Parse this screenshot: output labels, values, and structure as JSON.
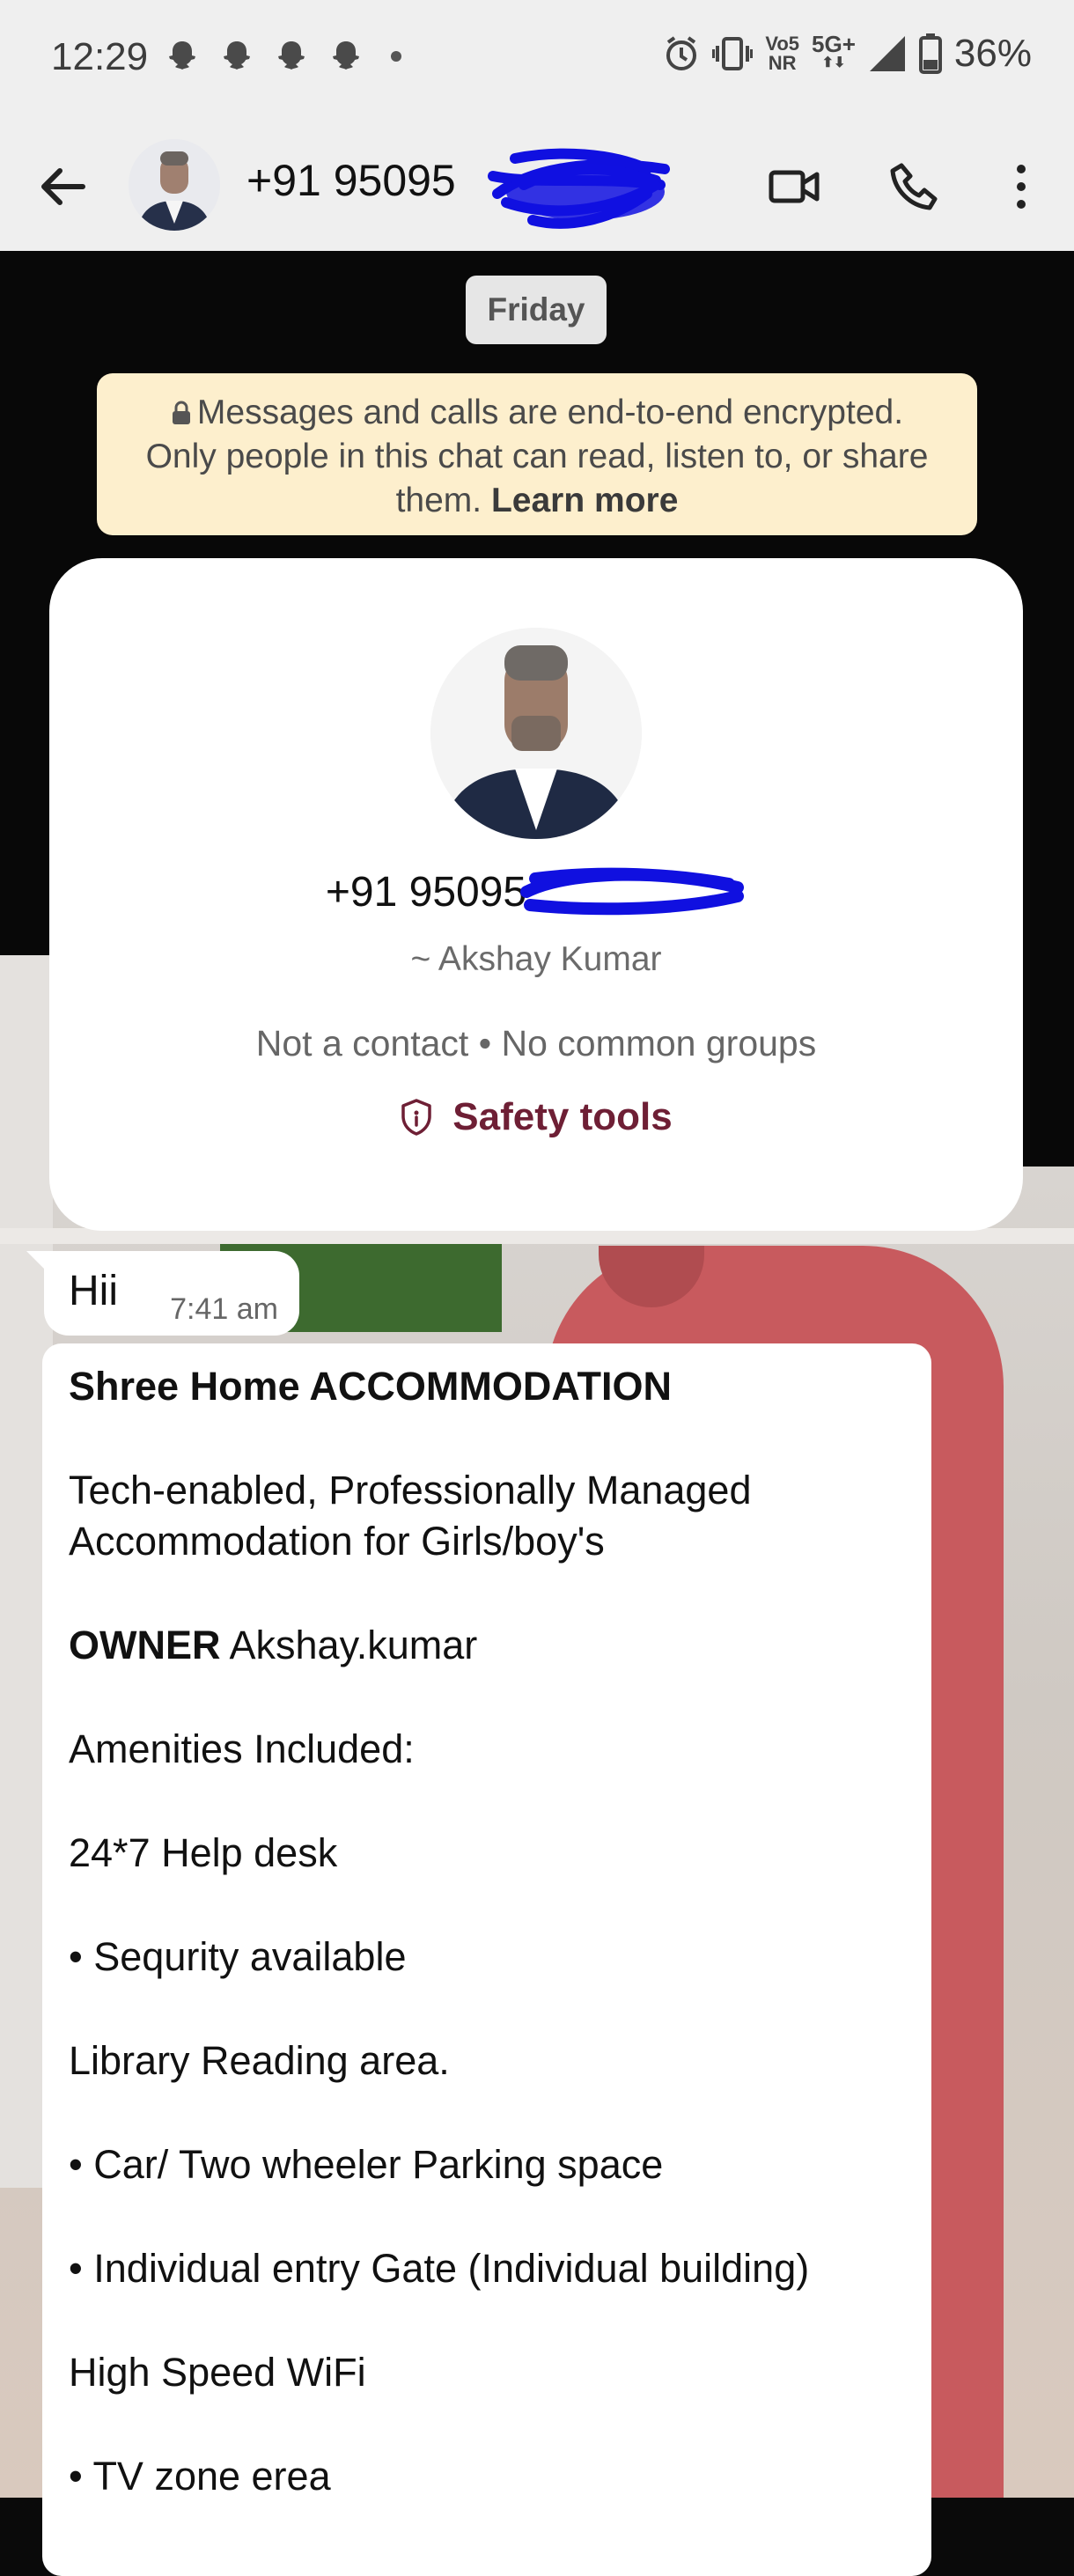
{
  "status_bar": {
    "time": "12:29",
    "network_top": "Vo5",
    "network_bottom": "NR",
    "net_type": "5G+",
    "battery": "36%"
  },
  "header": {
    "phone": "+91 95095",
    "icons": [
      "back-arrow-icon",
      "video-call-icon",
      "phone-call-icon",
      "more-options-icon"
    ]
  },
  "date_chip": "Friday",
  "encryption_notice": {
    "line1": "Messages and calls are end-to-end encrypted.",
    "line2": "Only people in this chat can read, listen to, or share",
    "line3": "them.",
    "learn_more": "Learn more"
  },
  "contact_card": {
    "phone": "+91 95095",
    "alias": "~ Akshay Kumar",
    "meta": "Not a contact • No common groups",
    "safety_label": "Safety tools"
  },
  "messages": {
    "hii": {
      "text": "Hii",
      "time": "7:41 am"
    },
    "listing": {
      "title": "Shree Home ACCOMMODATION",
      "tagline_1": "Tech-enabled, Professionally Managed",
      "tagline_2": "Accommodation for Girls/boy's",
      "owner_label": "OWNER",
      "owner_name": " Akshay.kumar",
      "amenities_heading": "Amenities Included:",
      "items": [
        "24*7 Help desk",
        "• Sequrity available",
        "Library Reading area.",
        "• Car/ Two wheeler Parking space",
        "• Individual entry Gate (Individual building)",
        "High Speed WiFi",
        "• TV zone erea"
      ]
    }
  }
}
